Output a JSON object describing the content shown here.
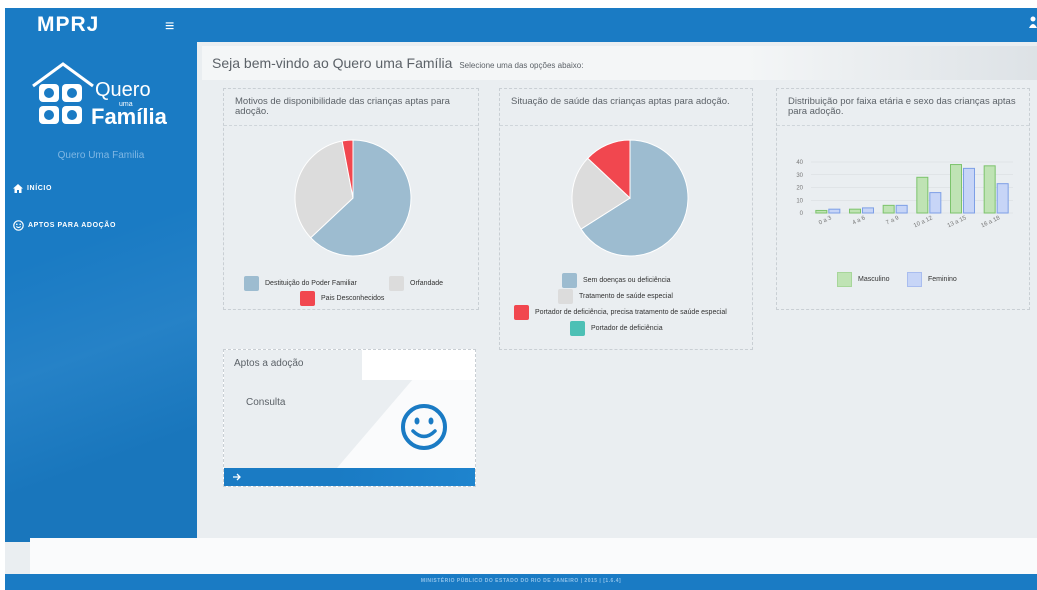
{
  "topbar": {
    "brand": "MPRJ",
    "menu_icon": "hamburger-icon",
    "user_icon": "user-icon"
  },
  "sidebar": {
    "logo_text_1": "Quero",
    "logo_text_small": "uma",
    "logo_text_2": "Família",
    "logo_subtitle": "Quero Uma Familia",
    "items": [
      {
        "label": "INÍCIO",
        "icon": "home-icon"
      },
      {
        "label": "APTOS PARA ADOÇÃO",
        "icon": "smiley-icon"
      }
    ]
  },
  "header": {
    "title": "Seja bem-vindo ao Quero uma Família",
    "subtitle": "Selecione uma das opções abaixo:"
  },
  "panels": {
    "reasons": {
      "title": "Motivos de disponibilidade das crianças aptas para adoção.",
      "legend": [
        "Destituição do Poder Familiar",
        "Orfandade",
        "Pais Desconhecidos"
      ]
    },
    "health": {
      "title": "Situação de saúde das crianças aptas para adoção.",
      "legend": [
        "Sem doenças ou deficiência",
        "Tratamento de saúde especial",
        "Portador de deficiência, precisa tratamento de saúde especial",
        "Portador de deficiência"
      ]
    },
    "ages": {
      "title": "Distribuição por faixa etária e sexo das crianças aptas para adoção.",
      "legend": [
        "Masculino",
        "Feminino"
      ]
    }
  },
  "aptos_card": {
    "title": "Aptos a adoção",
    "link": "Consulta",
    "icon": "smiley-icon",
    "footer_icon": "arrow-right-icon"
  },
  "footer": {
    "text": "MINISTÉRIO PÚBLICO DO ESTADO DO RIO DE JANEIRO | 2015 | [1.6.4]"
  },
  "colors": {
    "primary": "#1a7bc4",
    "pie_blue": "#9dbcd0",
    "pie_gray": "#dcdcdc",
    "pie_red": "#f1474f",
    "teal": "#4dc0b5",
    "green": "#bfe3b4",
    "lavender": "#c7d5f7"
  },
  "chart_data": [
    {
      "type": "pie",
      "labels": [
        "Destituição do Poder Familiar",
        "Orfandade",
        "Pais Desconhecidos"
      ],
      "values": [
        63,
        34,
        3
      ],
      "colors": [
        "#9dbcd0",
        "#dcdcdc",
        "#f1474f"
      ]
    },
    {
      "type": "pie",
      "labels": [
        "Sem doenças ou deficiência",
        "Tratamento de saúde especial",
        "Portador de deficiência, precisa tratamento de saúde especial",
        "Portador de deficiência"
      ],
      "values": [
        66,
        21,
        13,
        0
      ],
      "colors": [
        "#9dbcd0",
        "#dcdcdc",
        "#f1474f",
        "#4dc0b5"
      ]
    },
    {
      "type": "bar",
      "categories": [
        "0 a 3",
        "4 a 6",
        "7 a 9",
        "10 a 12",
        "13 a 15",
        "16 a 18"
      ],
      "series": [
        {
          "name": "Masculino",
          "values": [
            2,
            3,
            6,
            28,
            38,
            37
          ],
          "color": "#bfe3b4",
          "stroke": "#7cc36c"
        },
        {
          "name": "Feminino",
          "values": [
            3,
            4,
            6,
            16,
            35,
            23
          ],
          "color": "#c7d5f7",
          "stroke": "#7d9fe6"
        }
      ],
      "yticks": [
        0,
        10,
        20,
        30,
        40
      ],
      "ylim": [
        0,
        40
      ],
      "grid": true,
      "legend": "bottom"
    }
  ]
}
